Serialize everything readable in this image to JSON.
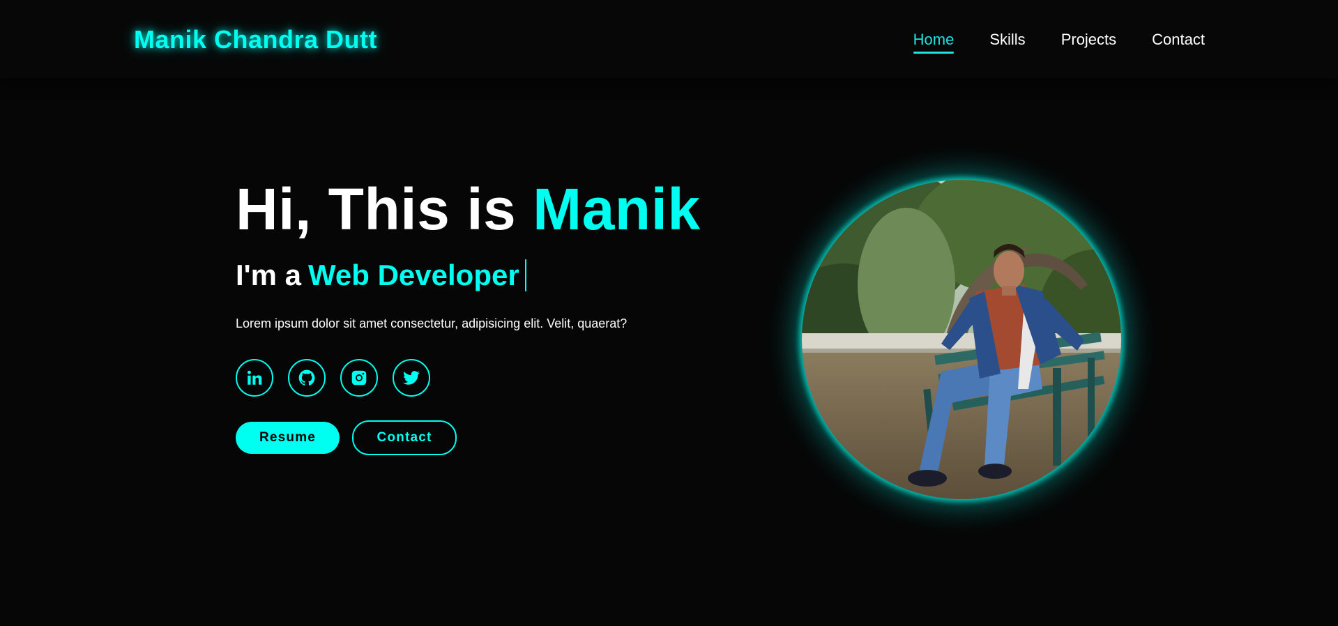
{
  "header": {
    "logo": "Manik Chandra Dutt",
    "nav": [
      {
        "label": "Home",
        "active": true
      },
      {
        "label": "Skills",
        "active": false
      },
      {
        "label": "Projects",
        "active": false
      },
      {
        "label": "Contact",
        "active": false
      }
    ]
  },
  "hero": {
    "greeting": "Hi, This is",
    "name": "Manik",
    "role_prefix": "I'm a",
    "role": "Web Developer",
    "description": "Lorem ipsum dolor sit amet consectetur, adipisicing elit. Velit, quaerat?",
    "socials": [
      {
        "icon": "linkedin-icon"
      },
      {
        "icon": "github-icon"
      },
      {
        "icon": "instagram-icon"
      },
      {
        "icon": "twitter-icon"
      }
    ],
    "buttons": {
      "resume": "Resume",
      "contact": "Contact"
    }
  },
  "profile_image": {
    "description_icon": "profile-photo"
  },
  "colors": {
    "background": "#060606",
    "accent": "#00fff0",
    "text": "#ffffff"
  }
}
